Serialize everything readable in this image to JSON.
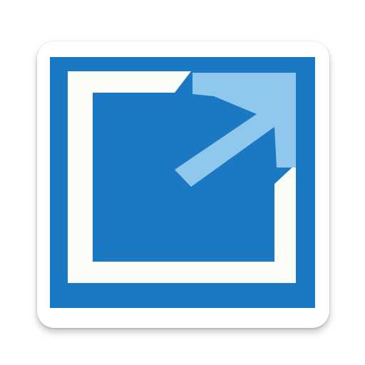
{
  "icon": {
    "name": "external-link-icon",
    "colors": {
      "tile_background": "#ffffff",
      "frame_blue": "#1b78c3",
      "inner_white": "#fafcf6",
      "arrow_light_blue": "#8fc8ec"
    }
  }
}
